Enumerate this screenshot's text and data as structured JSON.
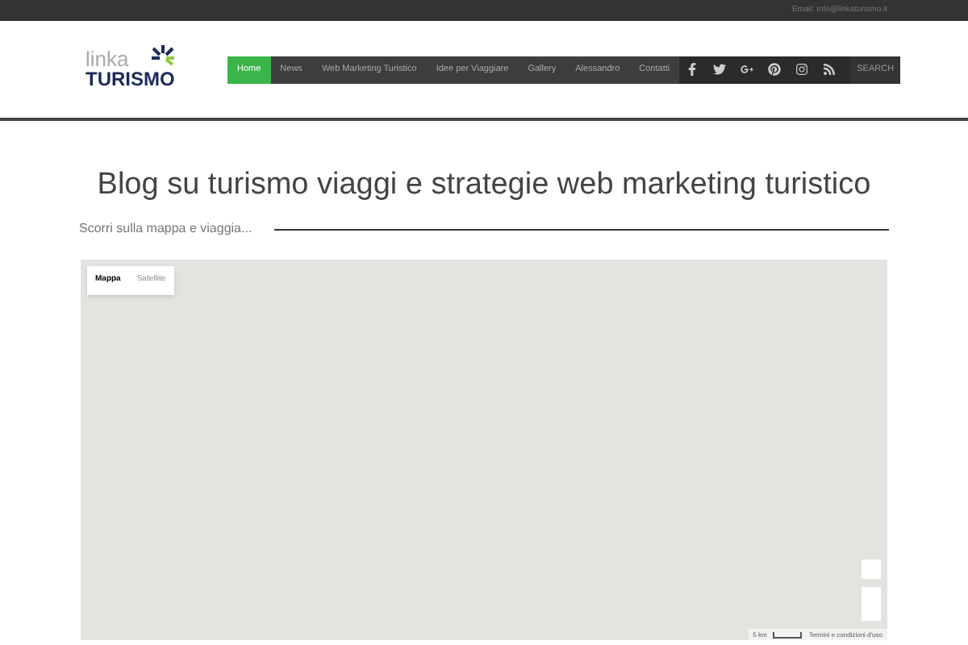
{
  "top_bar": {
    "email": "Email: info@linkaturismo.it"
  },
  "logo": {
    "word_top": "linka",
    "word_bottom": "TURISMO"
  },
  "nav": {
    "items": [
      {
        "label": "Home",
        "selected": true
      },
      {
        "label": "News",
        "selected": false
      },
      {
        "label": "Web Marketing Turistico",
        "selected": false
      },
      {
        "label": "Idee per Viaggiare",
        "selected": false
      },
      {
        "label": "Gallery",
        "selected": false
      },
      {
        "label": "Alessandro",
        "selected": false
      },
      {
        "label": "Contatti",
        "selected": false
      }
    ],
    "social": [
      {
        "kind": "facebook"
      },
      {
        "kind": "twitter"
      },
      {
        "kind": "googleplus"
      },
      {
        "kind": "pinterest"
      },
      {
        "kind": "instagram"
      },
      {
        "kind": "rss"
      }
    ],
    "search": "SEARCH"
  },
  "title": "Blog su turismo viaggi e strategie web marketing turistico",
  "subtitle": "Scorri sulla mappa e viaggia...",
  "map": {
    "types": [
      {
        "label": "Mappa",
        "selected": true
      },
      {
        "label": "Satellite",
        "selected": false
      }
    ],
    "scale": "5 km",
    "terms": "Termini e condizioni d'uso"
  }
}
